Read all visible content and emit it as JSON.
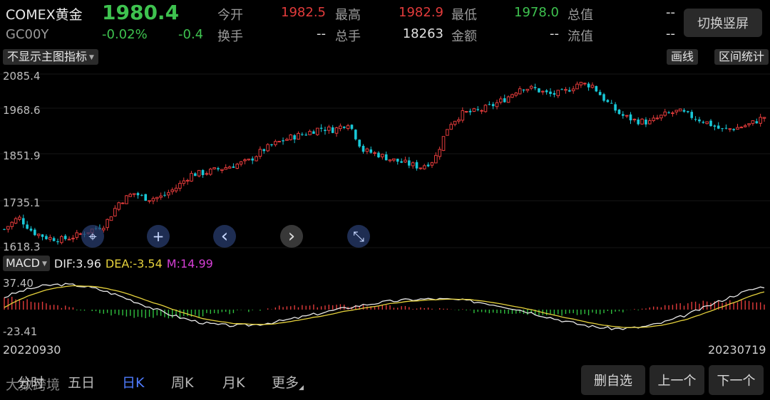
{
  "header": {
    "name": "COMEX黄金",
    "price": "1980.4",
    "code": "GC00Y",
    "change_pct": "-0.02%",
    "change": "-0.4",
    "stats": [
      {
        "label": "今开",
        "value": "1982.5",
        "color": "red"
      },
      {
        "label": "最高",
        "value": "1982.9",
        "color": "red"
      },
      {
        "label": "最低",
        "value": "1978.0",
        "color": "green"
      },
      {
        "label": "总值",
        "value": "--",
        "color": "white"
      },
      {
        "label": "换手",
        "value": "--",
        "color": "white"
      },
      {
        "label": "总手",
        "value": "18263",
        "color": "white"
      },
      {
        "label": "金额",
        "value": "--",
        "color": "white"
      },
      {
        "label": "流值",
        "value": "--",
        "color": "white"
      }
    ],
    "switch_button": "切换竖屏"
  },
  "toolbar": {
    "indicator_select": "不显示主图指标",
    "draw_button": "画线",
    "stats_button": "区间统计"
  },
  "price_axis": [
    "2085.4",
    "1968.6",
    "1851.9",
    "1735.1",
    "1618.3"
  ],
  "chart_controls": [
    {
      "icon": "crosshair-icon",
      "glyph": "⌖"
    },
    {
      "icon": "zoom-in-icon",
      "glyph": "+"
    },
    {
      "icon": "chevron-left-icon",
      "glyph": "‹"
    },
    {
      "icon": "chevron-right-icon",
      "glyph": "›"
    },
    {
      "icon": "collapse-icon",
      "glyph": "⤡"
    }
  ],
  "macd": {
    "select": "MACD",
    "dif": "DIF:3.96",
    "dea": "DEA:-3.54",
    "m": "M:14.99",
    "axis_top": "37.40",
    "axis_bottom": "-23.41"
  },
  "dates": {
    "start": "20220930",
    "end": "20230719"
  },
  "tabs": [
    {
      "label": "分时",
      "active": false
    },
    {
      "label": "五日",
      "active": false
    },
    {
      "label": "日K",
      "active": true
    },
    {
      "label": "周K",
      "active": false
    },
    {
      "label": "月K",
      "active": false
    },
    {
      "label": "更多",
      "active": false
    }
  ],
  "bottom_buttons": [
    "删自选",
    "上一个",
    "下一个"
  ],
  "watermark": "大数跨境",
  "colors": {
    "up": "#e23b3b",
    "down": "#18c7d6",
    "dif_line": "#e8e8e8",
    "dea_line": "#e6d23c",
    "accent": "#4f7cff"
  },
  "chart_data": {
    "type": "candlestick",
    "start_date": "20220930",
    "end_date": "20230719",
    "ylim": [
      1618.3,
      2085.4
    ],
    "close_path": [
      1668,
      1700,
      1660,
      1645,
      1640,
      1650,
      1665,
      1680,
      1740,
      1765,
      1750,
      1755,
      1780,
      1815,
      1820,
      1830,
      1840,
      1850,
      1880,
      1900,
      1915,
      1925,
      1940,
      1935,
      1955,
      1880,
      1870,
      1855,
      1845,
      1835,
      1855,
      1950,
      1980,
      1985,
      2000,
      2020,
      2050,
      2045,
      2030,
      2035,
      2060,
      2055,
      2010,
      1975,
      1960,
      1955,
      1975,
      1985,
      1970,
      1955,
      1935,
      1940,
      1950,
      1970
    ],
    "macd_ylim": [
      -23.41,
      37.4
    ]
  }
}
